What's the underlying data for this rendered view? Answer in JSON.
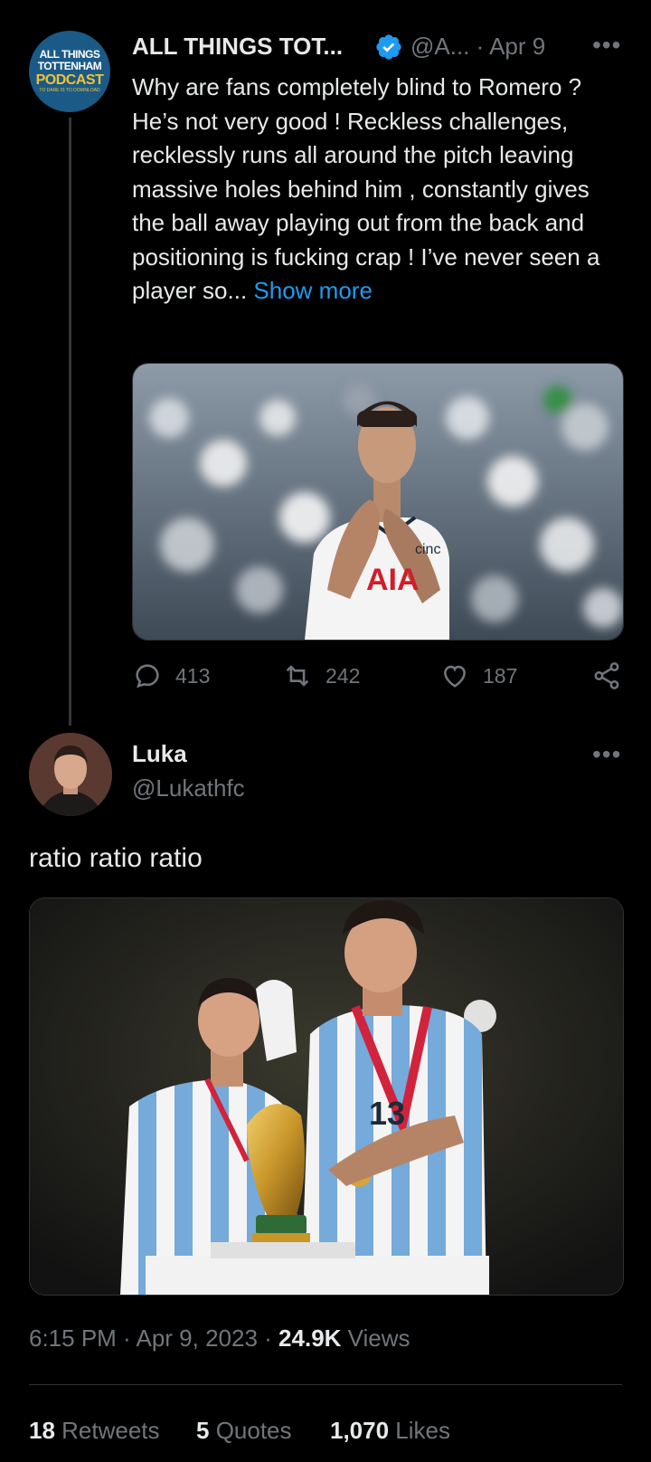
{
  "tweet": {
    "avatar": {
      "line1": "ALL THINGS",
      "line2": "TOTTENHAM",
      "line3": "PODCAST",
      "line4": "TO DARE IS TO DOWNLOAD"
    },
    "author_name": "ALL THINGS TOT...",
    "handle_date": "@A... · Apr 9",
    "more_icon": "•••",
    "text": "Why are fans completely blind to Romero ? He’s not very good ! Reckless challenges, recklessly runs all around the pitch leaving massive holes behind him , constantly gives the ball away playing out from the back and positioning is fucking crap ! I’ve never seen a player so... ",
    "show_more": "Show more",
    "image_text": "AIA",
    "image_sponsor": "cinc",
    "actions": {
      "replies": "413",
      "retweets": "242",
      "likes": "187"
    }
  },
  "reply": {
    "author_name": "Luka",
    "handle": "@Lukathfc",
    "more_icon": "•••",
    "text": "ratio ratio ratio",
    "shirt_number": "13",
    "time": "6:15 PM · Apr 9, 2023 · ",
    "views_count": "24.9K",
    "views_label": " Views",
    "stats": {
      "retweets_count": "18",
      "retweets_label": " Retweets",
      "quotes_count": "5",
      "quotes_label": " Quotes",
      "likes_count": "1,070",
      "likes_label": " Likes"
    }
  },
  "colors": {
    "background": "#000000",
    "text": "#e7e9ea",
    "muted": "#71767b",
    "accent": "#1d9bf0"
  }
}
